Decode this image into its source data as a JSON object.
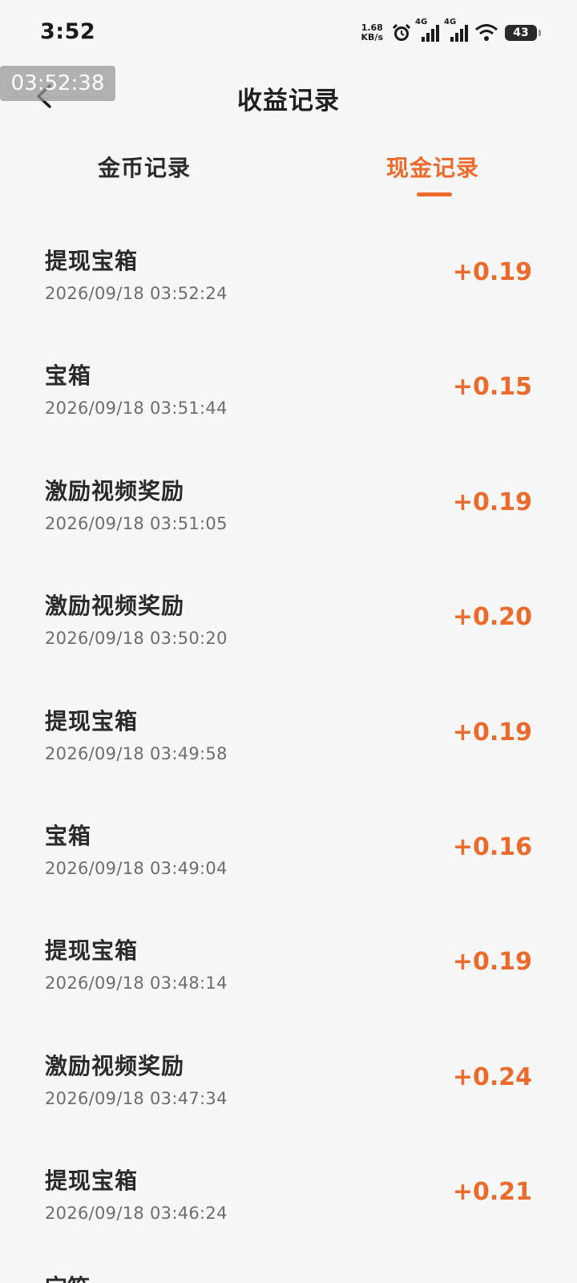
{
  "status_bar": {
    "time": "3:52",
    "net_speed_value": "1.68",
    "net_speed_unit": "KB/s",
    "network_1": "4G",
    "network_2": "4G",
    "battery": "43",
    "icons": [
      "alarm-icon",
      "signal-icon",
      "signal-icon",
      "wifi-icon",
      "battery-icon"
    ]
  },
  "clock_overlay": "03:52:38",
  "header": {
    "title": "收益记录",
    "back_icon": "chevron-left-icon"
  },
  "tabs": [
    {
      "label": "金币记录",
      "active": false
    },
    {
      "label": "现金记录",
      "active": true
    }
  ],
  "colors": {
    "accent": "#ec6a2c",
    "background": "#f7f7f7",
    "text_primary": "#2a2a2a",
    "text_secondary": "#6d6d6d"
  },
  "records": [
    {
      "title": "提现宝箱",
      "time": "2026/09/18 03:52:24",
      "amount": "+0.19"
    },
    {
      "title": "宝箱",
      "time": "2026/09/18 03:51:44",
      "amount": "+0.15"
    },
    {
      "title": "激励视频奖励",
      "time": "2026/09/18 03:51:05",
      "amount": "+0.19"
    },
    {
      "title": "激励视频奖励",
      "time": "2026/09/18 03:50:20",
      "amount": "+0.20"
    },
    {
      "title": "提现宝箱",
      "time": "2026/09/18 03:49:58",
      "amount": "+0.19"
    },
    {
      "title": "宝箱",
      "time": "2026/09/18 03:49:04",
      "amount": "+0.16"
    },
    {
      "title": "提现宝箱",
      "time": "2026/09/18 03:48:14",
      "amount": "+0.19"
    },
    {
      "title": "激励视频奖励",
      "time": "2026/09/18 03:47:34",
      "amount": "+0.24"
    },
    {
      "title": "提现宝箱",
      "time": "2026/09/18 03:46:24",
      "amount": "+0.21"
    }
  ],
  "partial_record_title": "宝箱"
}
